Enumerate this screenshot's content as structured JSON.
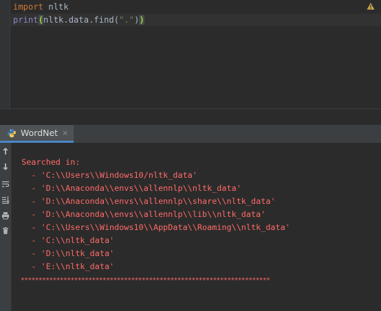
{
  "editor": {
    "lines": [
      {
        "keyword": "import",
        "rest": " nltk"
      },
      {
        "builtin": "print",
        "open": "(",
        "middle": "nltk.data.find(",
        "string": "\".\"",
        "close_inner": ")",
        "close": ")"
      }
    ]
  },
  "run_window": {
    "tab_label": "WordNet",
    "tab_close": "×"
  },
  "console": {
    "searched_label": "  Searched in:",
    "paths": [
      "    - 'C:\\\\Users\\\\Windows10/nltk_data'",
      "    - 'D:\\\\Anaconda\\\\envs\\\\allennlp\\\\nltk_data'",
      "    - 'D:\\\\Anaconda\\\\envs\\\\allennlp\\\\share\\\\nltk_data'",
      "    - 'D:\\\\Anaconda\\\\envs\\\\allennlp\\\\lib\\\\nltk_data'",
      "    - 'C:\\\\Users\\\\Windows10\\\\AppData\\\\Roaming\\\\nltk_data'",
      "    - 'C:\\\\nltk_data'",
      "    - 'D:\\\\nltk_data'",
      "    - 'E:\\\\nltk_data'"
    ],
    "separator": "**********************************************************************"
  },
  "colors": {
    "error_text": "#ff6b68",
    "keyword": "#cc7832",
    "builtin": "#8888c6",
    "string": "#6a8759",
    "tab_underline": "#4a88c7"
  },
  "icons": {
    "editor_warning": "warning-triangle-icon",
    "tab": "python-icon",
    "side_tools": [
      "up-arrow-icon",
      "down-arrow-icon",
      "soft-wrap-icon",
      "scroll-to-end-icon",
      "print-icon",
      "trash-icon"
    ]
  }
}
